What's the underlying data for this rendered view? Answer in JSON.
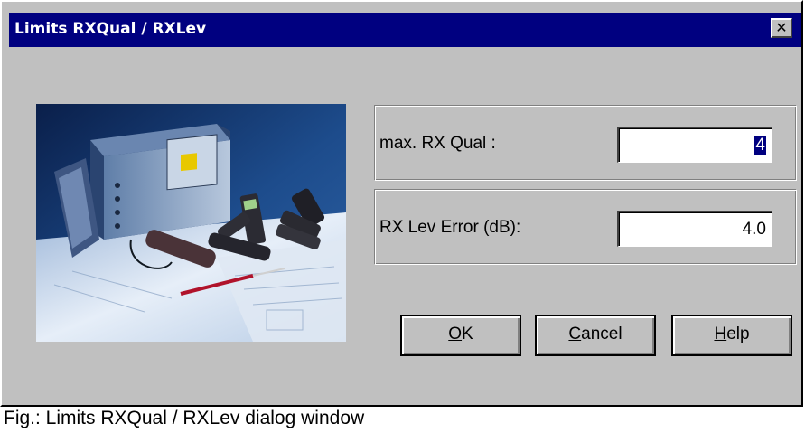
{
  "dialog": {
    "title": "Limits RXQual / RXLev",
    "close_glyph": "✕"
  },
  "fields": {
    "rx_qual_label": "max. RX Qual :",
    "rx_qual_value": "4",
    "rx_lev_label": "RX Lev Error (dB):",
    "rx_lev_value": "4.0"
  },
  "buttons": {
    "ok_mnemonic": "O",
    "ok_rest": "K",
    "cancel_mnemonic": "C",
    "cancel_rest": "ancel",
    "help_mnemonic": "H",
    "help_rest": "elp"
  },
  "caption": "Fig.: Limits RXQual / RXLev dialog window",
  "colors": {
    "titlebar": "#000080",
    "dialog_bg": "#c0c0c0"
  },
  "photo": {
    "icon": "test-equipment-photo"
  }
}
